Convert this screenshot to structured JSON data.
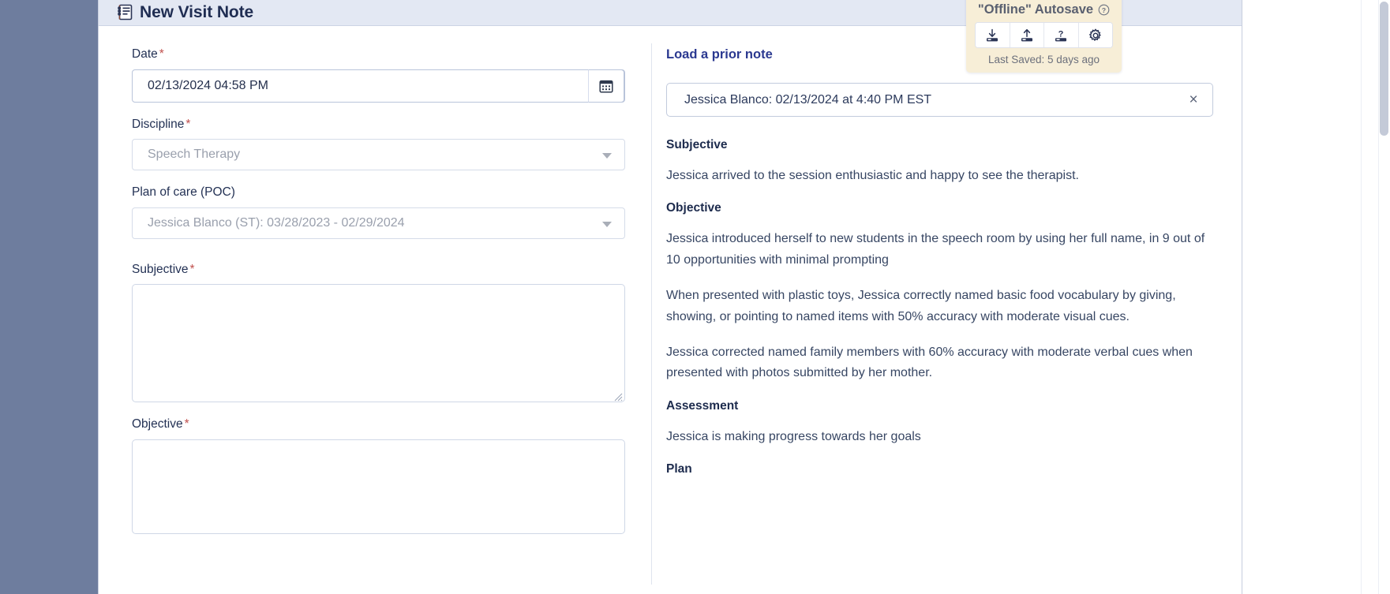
{
  "header": {
    "title": "New Visit Note",
    "icon": "notes-list-icon"
  },
  "form": {
    "date": {
      "label": "Date",
      "required": "*",
      "value": "02/13/2024 04:58 PM",
      "icon": "calendar-icon"
    },
    "discipline": {
      "label": "Discipline",
      "required": "*",
      "value": "Speech Therapy",
      "icon": "chevron-down-icon"
    },
    "poc": {
      "label": "Plan of care (POC)",
      "required": "",
      "value": "Jessica Blanco (ST): 03/28/2023 - 02/29/2024",
      "icon": "chevron-down-icon"
    },
    "subjective": {
      "label": "Subjective",
      "required": "*",
      "value": "",
      "placeholder": ""
    },
    "objective": {
      "label": "Objective",
      "required": "*",
      "value": "",
      "placeholder": ""
    }
  },
  "prior_note": {
    "link_label": "Load a prior note",
    "chip_text": "Jessica Blanco: 02/13/2024 at  4:40 PM EST",
    "close_icon": "close-icon",
    "sections": [
      {
        "heading": "Subjective",
        "paragraphs": [
          "Jessica arrived to the session enthusiastic and happy to see the therapist."
        ]
      },
      {
        "heading": "Objective",
        "paragraphs": [
          "Jessica introduced herself to new students in the speech room by using her full name, in 9 out of 10 opportunities with minimal prompting",
          "When presented with plastic toys, Jessica correctly named basic food vocabulary by giving, showing, or pointing to named items with 50% accuracy with moderate visual cues.",
          "Jessica corrected named family members with 60% accuracy with moderate verbal cues when presented with photos submitted by her mother."
        ]
      },
      {
        "heading": "Assessment",
        "paragraphs": [
          "Jessica is making progress towards her goals"
        ]
      },
      {
        "heading": "Plan",
        "paragraphs": []
      }
    ]
  },
  "autosave": {
    "title": "\"Offline\" Autosave",
    "help_icon": "question-circle-icon",
    "buttons": [
      {
        "name": "download-save-icon",
        "label": ""
      },
      {
        "name": "upload-save-icon",
        "label": ""
      },
      {
        "name": "question-save-icon",
        "label": ""
      },
      {
        "name": "gear-icon",
        "label": ""
      }
    ],
    "status": "Last Saved: 5 days ago"
  },
  "colors": {
    "backdrop": "#6e7d9e",
    "header_bg": "#e3e8f3",
    "title": "#1f2d52",
    "link": "#2b3990",
    "required": "#c0504d",
    "autosave_bg": "#f7eed7",
    "body_text": "#374663"
  }
}
